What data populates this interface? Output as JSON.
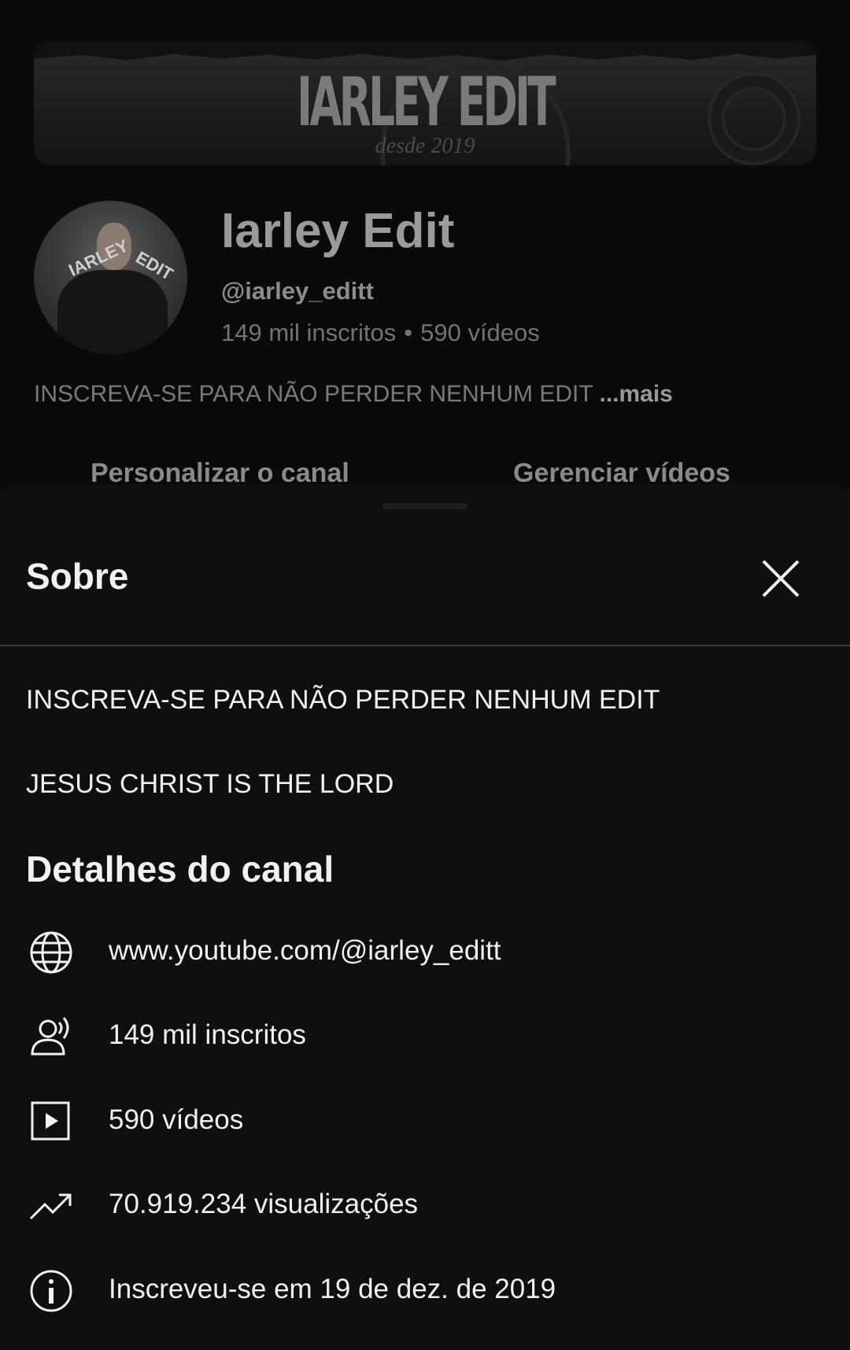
{
  "banner": {
    "logo_text": "IARLEY EDIT",
    "since_text": "desde 2019"
  },
  "channel": {
    "name": "Iarley Edit",
    "handle": "@iarley_editt",
    "subscribers": "149 mil inscritos",
    "separator": "•",
    "videos": "590 vídeos",
    "description_preview": "INSCREVA-SE PARA NÃO PERDER NENHUM EDIT",
    "more_label": "...mais",
    "customize_button": "Personalizar o canal",
    "manage_button": "Gerenciar vídeos"
  },
  "avatar": {
    "text_left": "IARLEY",
    "text_right": "EDIT"
  },
  "sheet": {
    "title": "Sobre",
    "about_lines": [
      "INSCREVA-SE PARA NÃO PERDER NENHUM EDIT",
      "JESUS CHRIST IS THE LORD"
    ],
    "details_title": "Detalhes do canal",
    "details": [
      {
        "icon": "globe-icon",
        "text": "www.youtube.com/@iarley_editt"
      },
      {
        "icon": "subscribers-icon",
        "text": "149 mil inscritos"
      },
      {
        "icon": "video-play-icon",
        "text": "590 vídeos"
      },
      {
        "icon": "trending-icon",
        "text": "70.919.234 visualizações"
      },
      {
        "icon": "info-icon",
        "text": "Inscreveu-se em 19 de dez. de 2019"
      }
    ]
  }
}
